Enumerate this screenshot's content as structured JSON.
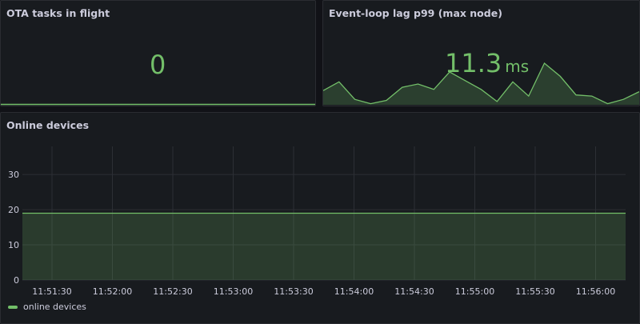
{
  "panels": {
    "ota": {
      "title": "OTA tasks in flight",
      "value": "0"
    },
    "lag": {
      "title": "Event-loop lag p99 (max node)",
      "value": "11.3",
      "unit": "ms",
      "sparkline": [
        1.3,
        2.1,
        0.5,
        0.1,
        0.4,
        1.6,
        1.9,
        1.4,
        3.0,
        2.2,
        1.4,
        0.3,
        2.1,
        0.8,
        3.8,
        2.6,
        0.9,
        0.8,
        0.1,
        0.5,
        1.2
      ]
    },
    "devices": {
      "title": "Online devices",
      "legend_label": "online devices"
    }
  },
  "colors": {
    "accent": "#73bf69",
    "panel_bg": "#181b1f",
    "page_bg": "#111217",
    "grid": "#2c2f35",
    "text": "#ccccdc"
  },
  "chart_data": {
    "type": "area",
    "series": [
      {
        "name": "online devices",
        "x": [
          "11:51:15",
          "11:56:15"
        ],
        "values": [
          19,
          19
        ]
      }
    ],
    "x_ticks": [
      "11:51:30",
      "11:52:00",
      "11:52:30",
      "11:53:00",
      "11:53:30",
      "11:54:00",
      "11:54:30",
      "11:55:00",
      "11:55:30",
      "11:56:00"
    ],
    "y_ticks": [
      "0",
      "10",
      "20",
      "30"
    ],
    "ylim": [
      0,
      38
    ],
    "grid": true,
    "legend": "bottom-left"
  }
}
